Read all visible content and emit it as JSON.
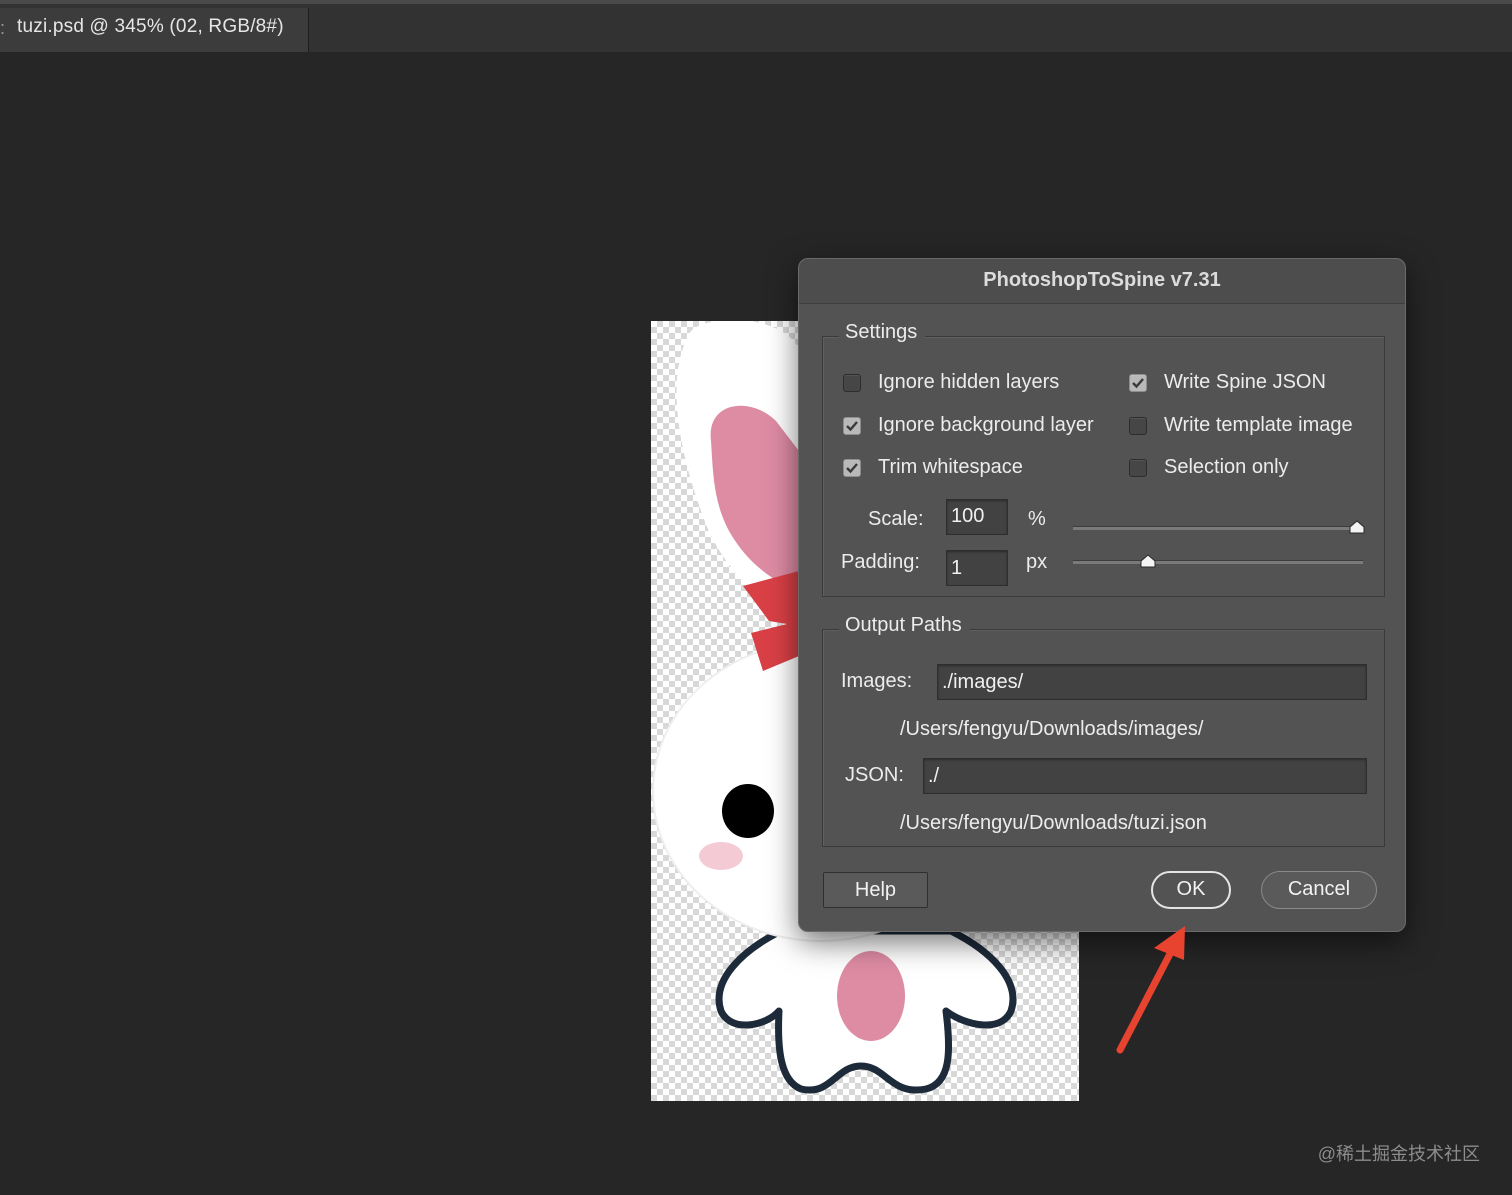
{
  "document_tab": {
    "title": "tuzi.psd @ 345% (02, RGB/8#)",
    "grip": ":"
  },
  "dialog": {
    "title": "PhotoshopToSpine v7.31",
    "settings": {
      "legend": "Settings",
      "options": [
        {
          "label": "Ignore hidden layers",
          "checked": false
        },
        {
          "label": "Write Spine JSON",
          "checked": true
        },
        {
          "label": "Ignore background layer",
          "checked": true
        },
        {
          "label": "Write template image",
          "checked": false
        },
        {
          "label": "Trim whitespace",
          "checked": true
        },
        {
          "label": "Selection only",
          "checked": false
        }
      ],
      "scale": {
        "label": "Scale:",
        "value": "100",
        "unit": "%",
        "slider_fraction": 0.98
      },
      "padding": {
        "label": "Padding:",
        "value": "1",
        "unit": "px",
        "slider_fraction": 0.26
      }
    },
    "output_paths": {
      "legend": "Output Paths",
      "images": {
        "label": "Images:",
        "value": "./images/",
        "resolved": "/Users/fengyu/Downloads/images/"
      },
      "json": {
        "label": "JSON:",
        "value": "./",
        "resolved": "/Users/fengyu/Downloads/tuzi.json"
      }
    },
    "buttons": {
      "help": "Help",
      "ok": "OK",
      "cancel": "Cancel"
    }
  },
  "annotation": {
    "arrow_color": "#e8432f",
    "points_to": "OK"
  },
  "watermark": "@稀土掘金技术社区",
  "colors": {
    "bunny_ear_pink": "#de8ba4",
    "bow_red": "#d94046",
    "outline": "#1d2a3a"
  }
}
